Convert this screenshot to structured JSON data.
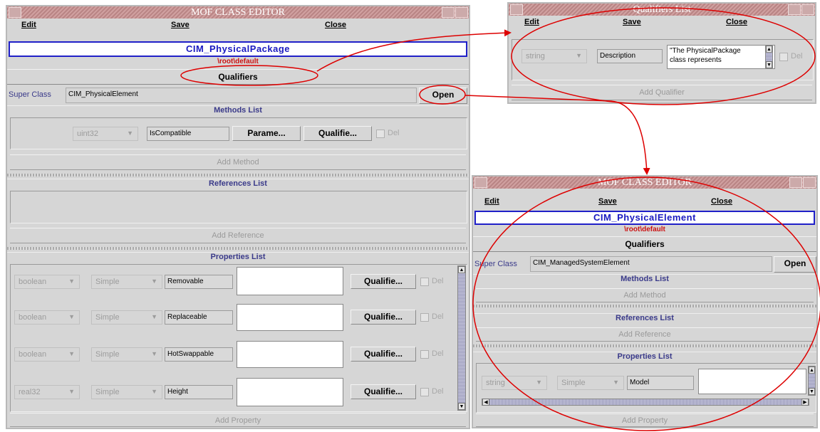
{
  "main_window": {
    "title": "MOF CLASS EDITOR",
    "menu": {
      "edit": "Edit",
      "save": "Save",
      "close": "Close"
    },
    "class_name": "CIM_PhysicalPackage",
    "namespace": "\\root\\default",
    "qualifiers_label": "Qualifiers",
    "super_class_label": "Super Class",
    "super_class_value": "CIM_PhysicalElement",
    "open_label": "Open",
    "methods_list_title": "Methods List",
    "methods": [
      {
        "type": "uint32",
        "name": "IsCompatible",
        "params_label": "Parame...",
        "qual_label": "Qualifie...",
        "del_label": "Del"
      }
    ],
    "add_method_label": "Add Method",
    "references_list_title": "References List",
    "add_reference_label": "Add Reference",
    "properties_list_title": "Properties List",
    "properties": [
      {
        "type": "boolean",
        "kind": "Simple",
        "name": "Removable",
        "qual_label": "Qualifie...",
        "del_label": "Del"
      },
      {
        "type": "boolean",
        "kind": "Simple",
        "name": "Replaceable",
        "qual_label": "Qualifie...",
        "del_label": "Del"
      },
      {
        "type": "boolean",
        "kind": "Simple",
        "name": "HotSwappable",
        "qual_label": "Qualifie...",
        "del_label": "Del"
      },
      {
        "type": "real32",
        "kind": "Simple",
        "name": "Height",
        "qual_label": "Qualifie...",
        "del_label": "Del"
      }
    ],
    "add_property_label": "Add Property"
  },
  "qualifiers_window": {
    "title": "Qualifiers List",
    "menu": {
      "edit": "Edit",
      "save": "Save",
      "close": "Close"
    },
    "qualifier": {
      "type": "string",
      "name": "Description",
      "value_line1": "\"The PhysicalPackage",
      "value_line2": "class represents",
      "del_label": "Del"
    },
    "add_qualifier_label": "Add Qualifier"
  },
  "super_window": {
    "title": "MOF CLASS EDITOR",
    "menu": {
      "edit": "Edit",
      "save": "Save",
      "close": "Close"
    },
    "class_name": "CIM_PhysicalElement",
    "namespace": "\\root\\default",
    "qualifiers_label": "Qualifiers",
    "super_class_label": "Super Class",
    "super_class_value": "CIM_ManagedSystemElement",
    "open_label": "Open",
    "methods_list_title": "Methods List",
    "add_method_label": "Add Method",
    "references_list_title": "References List",
    "add_reference_label": "Add Reference",
    "properties_list_title": "Properties List",
    "property": {
      "type": "string",
      "kind": "Simple",
      "name": "Model"
    },
    "add_property_label": "Add Property"
  },
  "colors": {
    "annotation": "#dd0000",
    "class_border": "#2020c8",
    "namespace": "#cc1111"
  }
}
